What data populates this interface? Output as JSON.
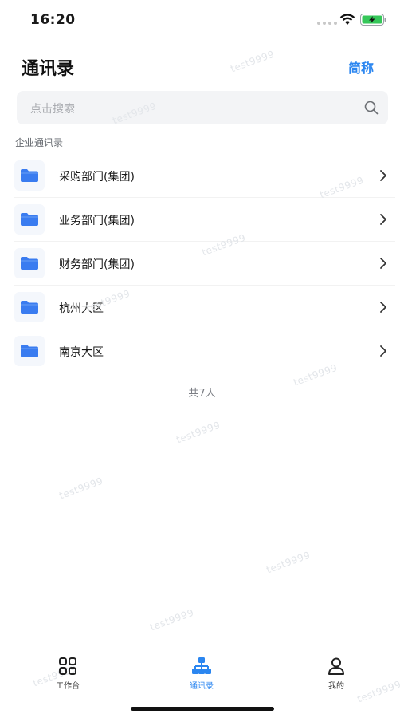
{
  "status_bar": {
    "time": "16:20"
  },
  "header": {
    "title": "通讯录",
    "abbr_button": "简称"
  },
  "search": {
    "placeholder": "点击搜索"
  },
  "section": {
    "label": "企业通讯录"
  },
  "departments": [
    {
      "label": "采购部门(集团)",
      "icon": "folder-icon"
    },
    {
      "label": "业务部门(集团)",
      "icon": "folder-icon"
    },
    {
      "label": "财务部门(集团)",
      "icon": "folder-icon"
    },
    {
      "label": "杭州大区",
      "icon": "folder-icon"
    },
    {
      "label": "南京大区",
      "icon": "folder-icon"
    }
  ],
  "total": "共7人",
  "watermark": "test9999",
  "tabbar": {
    "tabs": [
      {
        "label": "工作台",
        "icon": "grid-icon",
        "active": false
      },
      {
        "label": "通讯录",
        "icon": "org-chart-icon",
        "active": true
      },
      {
        "label": "我的",
        "icon": "person-icon",
        "active": false
      }
    ]
  },
  "colors": {
    "accent": "#2b86f0",
    "folder": "#3a7cf0",
    "search_bg": "#f3f4f6"
  }
}
